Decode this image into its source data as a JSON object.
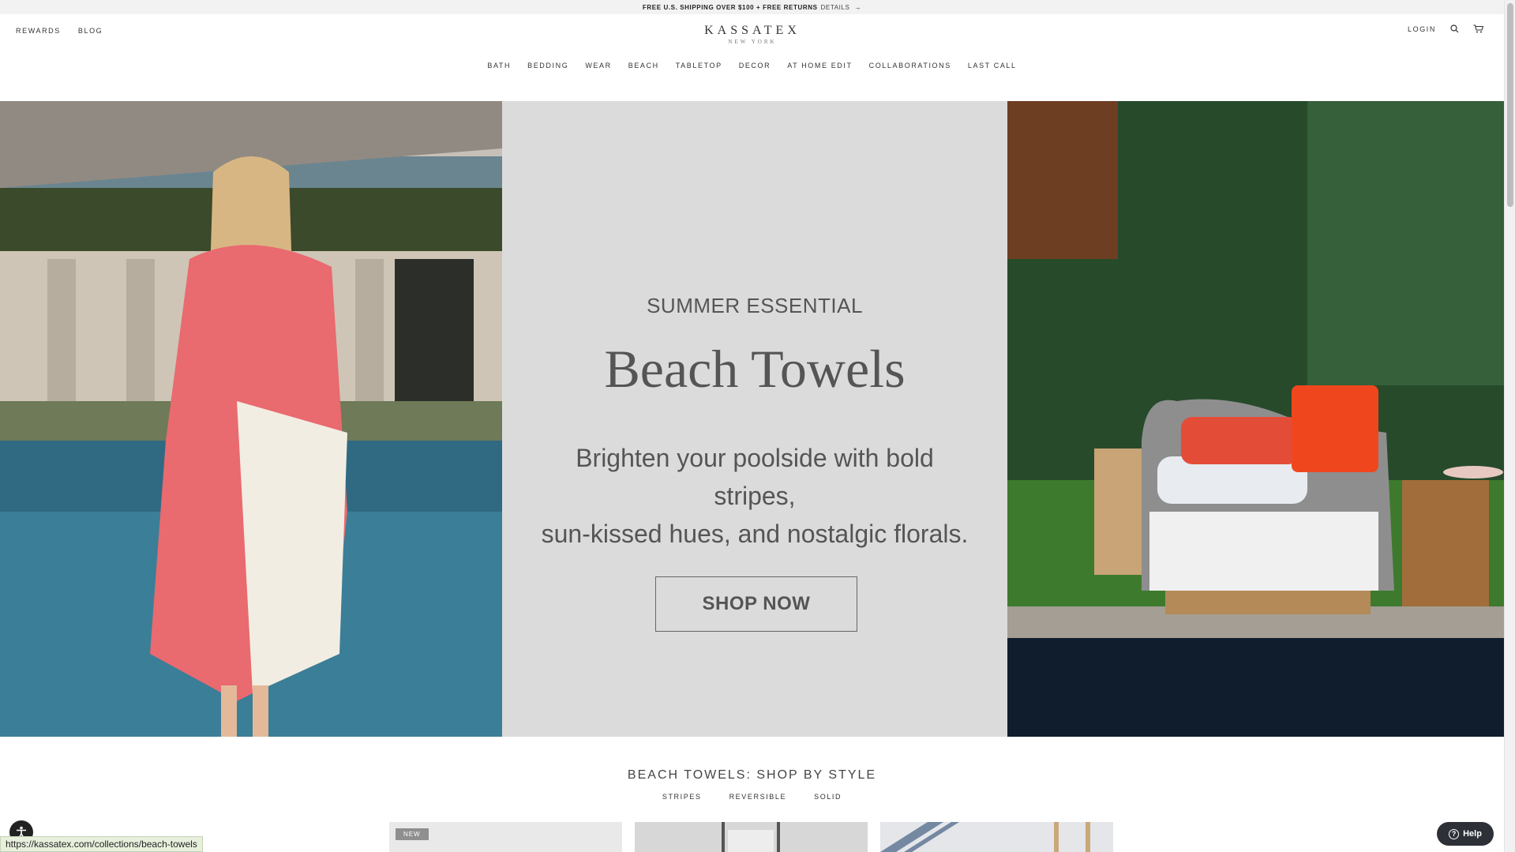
{
  "announcement": {
    "text": "FREE U.S. SHIPPING OVER $100 + FREE RETURNS",
    "details": "DETAILS",
    "arrow": "→"
  },
  "utility_left": [
    "REWARDS",
    "BLOG"
  ],
  "logo": {
    "brand": "KASSATEX",
    "city": "NEW YORK"
  },
  "utility_right": {
    "login": "LOGIN",
    "icons": [
      "search-icon",
      "cart-icon"
    ]
  },
  "nav": [
    "BATH",
    "BEDDING",
    "WEAR",
    "BEACH",
    "TABLETOP",
    "DECOR",
    "AT HOME EDIT",
    "COLLABORATIONS",
    "LAST CALL"
  ],
  "hero": {
    "eyebrow": "SUMMER ESSENTIAL",
    "headline": "Beach Towels",
    "subtitle_line1": "Brighten your poolside with bold stripes,",
    "subtitle_line2": "sun-kissed hues, and nostalgic florals.",
    "cta": "SHOP NOW",
    "panel_color": "#dcdbdc"
  },
  "shop_by_style": {
    "title": "BEACH TOWELS: SHOP BY STYLE",
    "tabs": [
      "STRIPES",
      "REVERSIBLE",
      "SOLID"
    ],
    "first_card_badge": "NEW"
  },
  "status_bar": {
    "url": "https://kassatex.com/collections/beach-towels"
  },
  "help": {
    "label": "Help"
  },
  "accessibility": {
    "icon": "accessibility-icon"
  }
}
